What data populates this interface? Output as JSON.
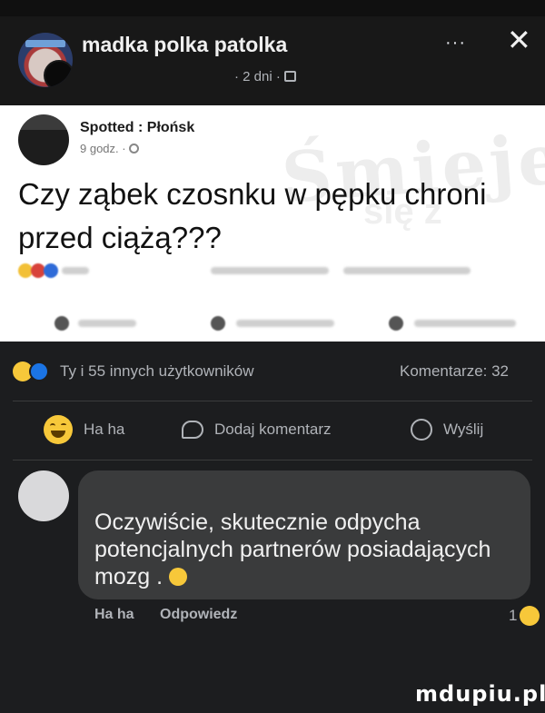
{
  "header": {
    "group_name": "madka polka patolka",
    "post_meta": "· 2 dni ·",
    "more_label": "···",
    "close_label": "✕"
  },
  "shared_post": {
    "page_name": "Spotted : Płońsk",
    "time": "9 godz. ·",
    "headline": "Czy ząbek czosnku w pępku chroni przed ciążą???"
  },
  "stats": {
    "reactors": "Ty i 55 innych użytkowników",
    "comments_count": "Komentarze: 32"
  },
  "actions": {
    "reaction_label": "Ha ha",
    "comment_label": "Dodaj komentarz",
    "send_label": "Wyślij"
  },
  "comment": {
    "text": "Oczywiście, skutecznie odpycha potencjalnych partnerów posiadających mozg .",
    "reaction_label": "Ha ha",
    "reply_label": "Odpowiedz",
    "reaction_count": "1"
  },
  "watermark": "mdupiu.pl",
  "colors": {
    "background": "#1c1d1f",
    "bubble": "#3a3b3c",
    "like_blue": "#1b74e4",
    "laugh_yellow": "#f7c83a"
  }
}
